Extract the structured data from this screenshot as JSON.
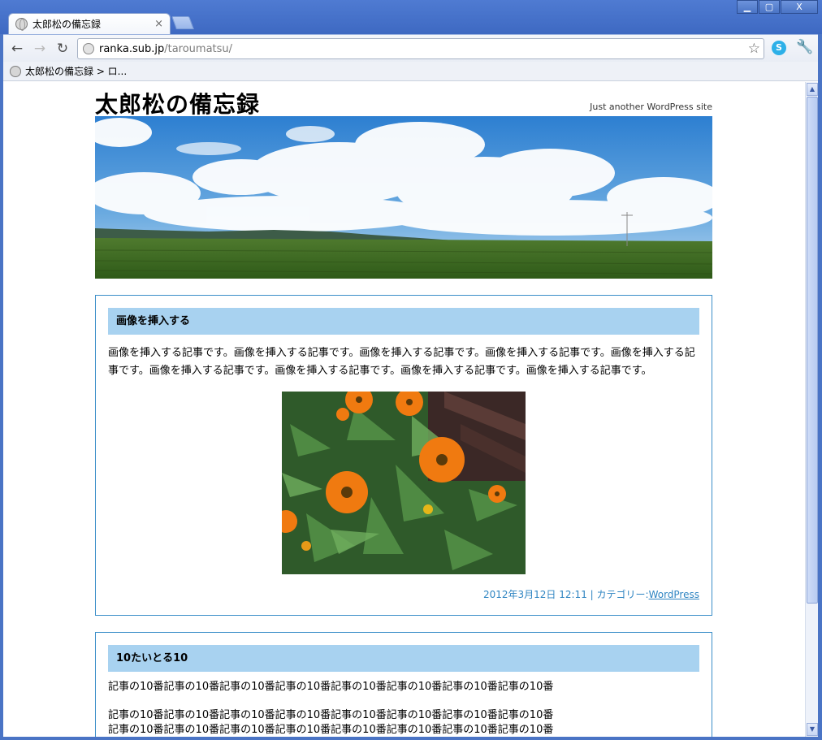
{
  "browser": {
    "tab_title": "太郎松の備忘録",
    "tab_close": "×",
    "window_buttons": [
      "▁",
      "▢",
      "X"
    ],
    "url_host": "ranka.sub.jp",
    "url_path": "/taroumatsu/",
    "bookmark_label": "太郎松の備忘録 > ロ...",
    "ext_label": "S"
  },
  "site": {
    "title": "太郎松の備忘録",
    "description": "Just another WordPress site"
  },
  "posts": [
    {
      "title": "画像を挿入する",
      "body": "画像を挿入する記事です。画像を挿入する記事です。画像を挿入する記事です。画像を挿入する記事です。画像を挿入する記事です。画像を挿入する記事です。画像を挿入する記事です。画像を挿入する記事です。画像を挿入する記事です。",
      "date": "2012年3月12日 12:11",
      "category_prefix": "| カテゴリー:",
      "category_link": "WordPress"
    },
    {
      "title": "10たいとる10",
      "paragraphs": [
        "記事の10番記事の10番記事の10番記事の10番記事の10番記事の10番記事の10番記事の10番",
        "記事の10番記事の10番記事の10番記事の10番記事の10番記事の10番記事の10番記事の10番",
        "記事の10番記事の10番記事の10番記事の10番記事の10番記事の10番記事の10番記事の10番"
      ]
    }
  ],
  "colors": {
    "title_bar": "#4f7bd2",
    "post_border": "#3a8ec8",
    "post_title_bg": "#a8d2f0",
    "meta_text": "#2f85c2"
  }
}
